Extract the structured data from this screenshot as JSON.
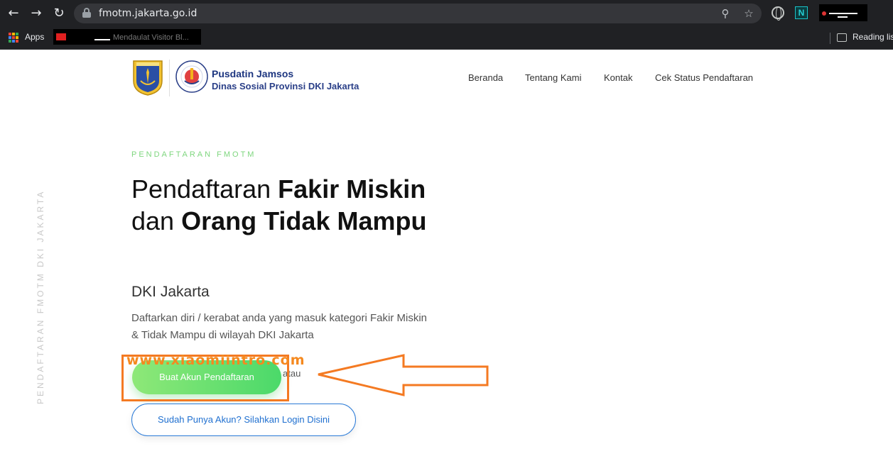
{
  "browser": {
    "url": "fmotm.jakarta.go.id",
    "bookmarks_apps_label": "Apps",
    "bookmark_faded_text": "Mendaulat Visitor Bl...",
    "reading_list_label": "Reading list",
    "icons": [
      "back-icon",
      "forward-icon",
      "reload-icon",
      "lock-icon",
      "zoom-icon",
      "star-icon",
      "globe-icon",
      "n-extension-icon",
      "reading-list-icon"
    ]
  },
  "header": {
    "org_name": "Pusdatin Jamsos",
    "org_subtitle": "Dinas Sosial Provinsi DKI Jakarta",
    "nav": [
      "Beranda",
      "Tentang Kami",
      "Kontak",
      "Cek Status Pendaftaran"
    ]
  },
  "side": {
    "vertical_text": "PENDAFTARAN FMOTM DKI JAKARTA"
  },
  "hero": {
    "eyebrow": "PENDAFTARAN FMOTM",
    "title_part1": "Pendaftaran ",
    "title_bold1": "Fakir Miskin",
    "title_part2": " dan ",
    "title_bold2": "Orang Tidak Mampu",
    "subheading": "DKI Jakarta",
    "description": "Daftarkan diri / kerabat anda yang masuk kategori Fakir Miskin & Tidak Mampu di wilayah DKI Jakarta",
    "register_button": "Buat Akun Pendaftaran",
    "or_text": "atau",
    "login_button": "Sudah Punya Akun? Silahkan Login Disini"
  },
  "annotation": {
    "watermark": "www.xiaomiintro.com",
    "accent_color": "#f47a22"
  }
}
